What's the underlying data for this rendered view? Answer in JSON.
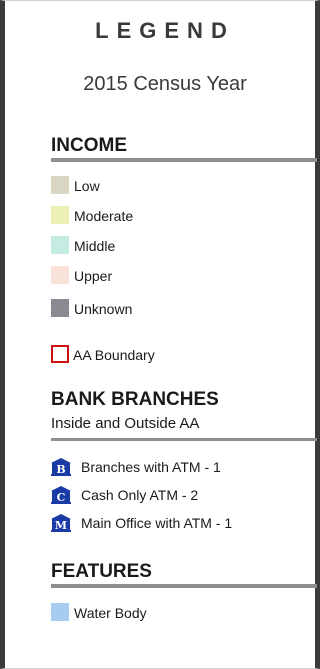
{
  "legend": {
    "title": "LEGEND",
    "census_year": "2015 Census Year"
  },
  "income": {
    "heading": "INCOME",
    "items": [
      {
        "label": "Low",
        "color": "#d9d6c3"
      },
      {
        "label": "Moderate",
        "color": "#eef1b4"
      },
      {
        "label": "Middle",
        "color": "#c4ece2"
      },
      {
        "label": "Upper",
        "color": "#f8e2da"
      },
      {
        "label": "Unknown",
        "color": "#8a8b91"
      }
    ],
    "aa_boundary": {
      "label": "AA Boundary",
      "color": "#cc1111"
    }
  },
  "bank_branches": {
    "heading": "BANK BRANCHES",
    "subheading": "Inside and Outside AA",
    "items": [
      {
        "icon": "bank-B-icon",
        "letter": "B",
        "label": "Branches with ATM - 1"
      },
      {
        "icon": "bank-C-icon",
        "letter": "C",
        "label": "Cash Only ATM - 2"
      },
      {
        "icon": "bank-M-icon",
        "letter": "M",
        "label": "Main Office with ATM - 1"
      }
    ],
    "icon_color": "#1a3aa6"
  },
  "features": {
    "heading": "FEATURES",
    "items": [
      {
        "label": "Water Body",
        "color": "#a6cdf0"
      }
    ]
  }
}
